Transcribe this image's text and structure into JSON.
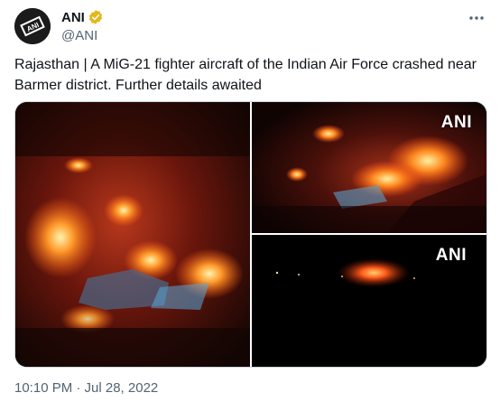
{
  "author": {
    "name": "ANI",
    "handle": "@ANI",
    "avatar_text": "ANI",
    "verified_color": "#e2b719"
  },
  "tweet": {
    "text": "Rajasthan | A MiG-21 fighter aircraft of the Indian Air Force crashed near Barmer district. Further details awaited"
  },
  "media": {
    "watermark": "ANI",
    "images": [
      {
        "icon": "fire-photo"
      },
      {
        "icon": "fire-photo"
      },
      {
        "icon": "fire-distant-photo"
      }
    ]
  },
  "meta": {
    "timestamp": "10:10 PM · Jul 28, 2022"
  },
  "colors": {
    "text_primary": "#0f1419",
    "text_secondary": "#536471",
    "border": "#cfd9de"
  }
}
